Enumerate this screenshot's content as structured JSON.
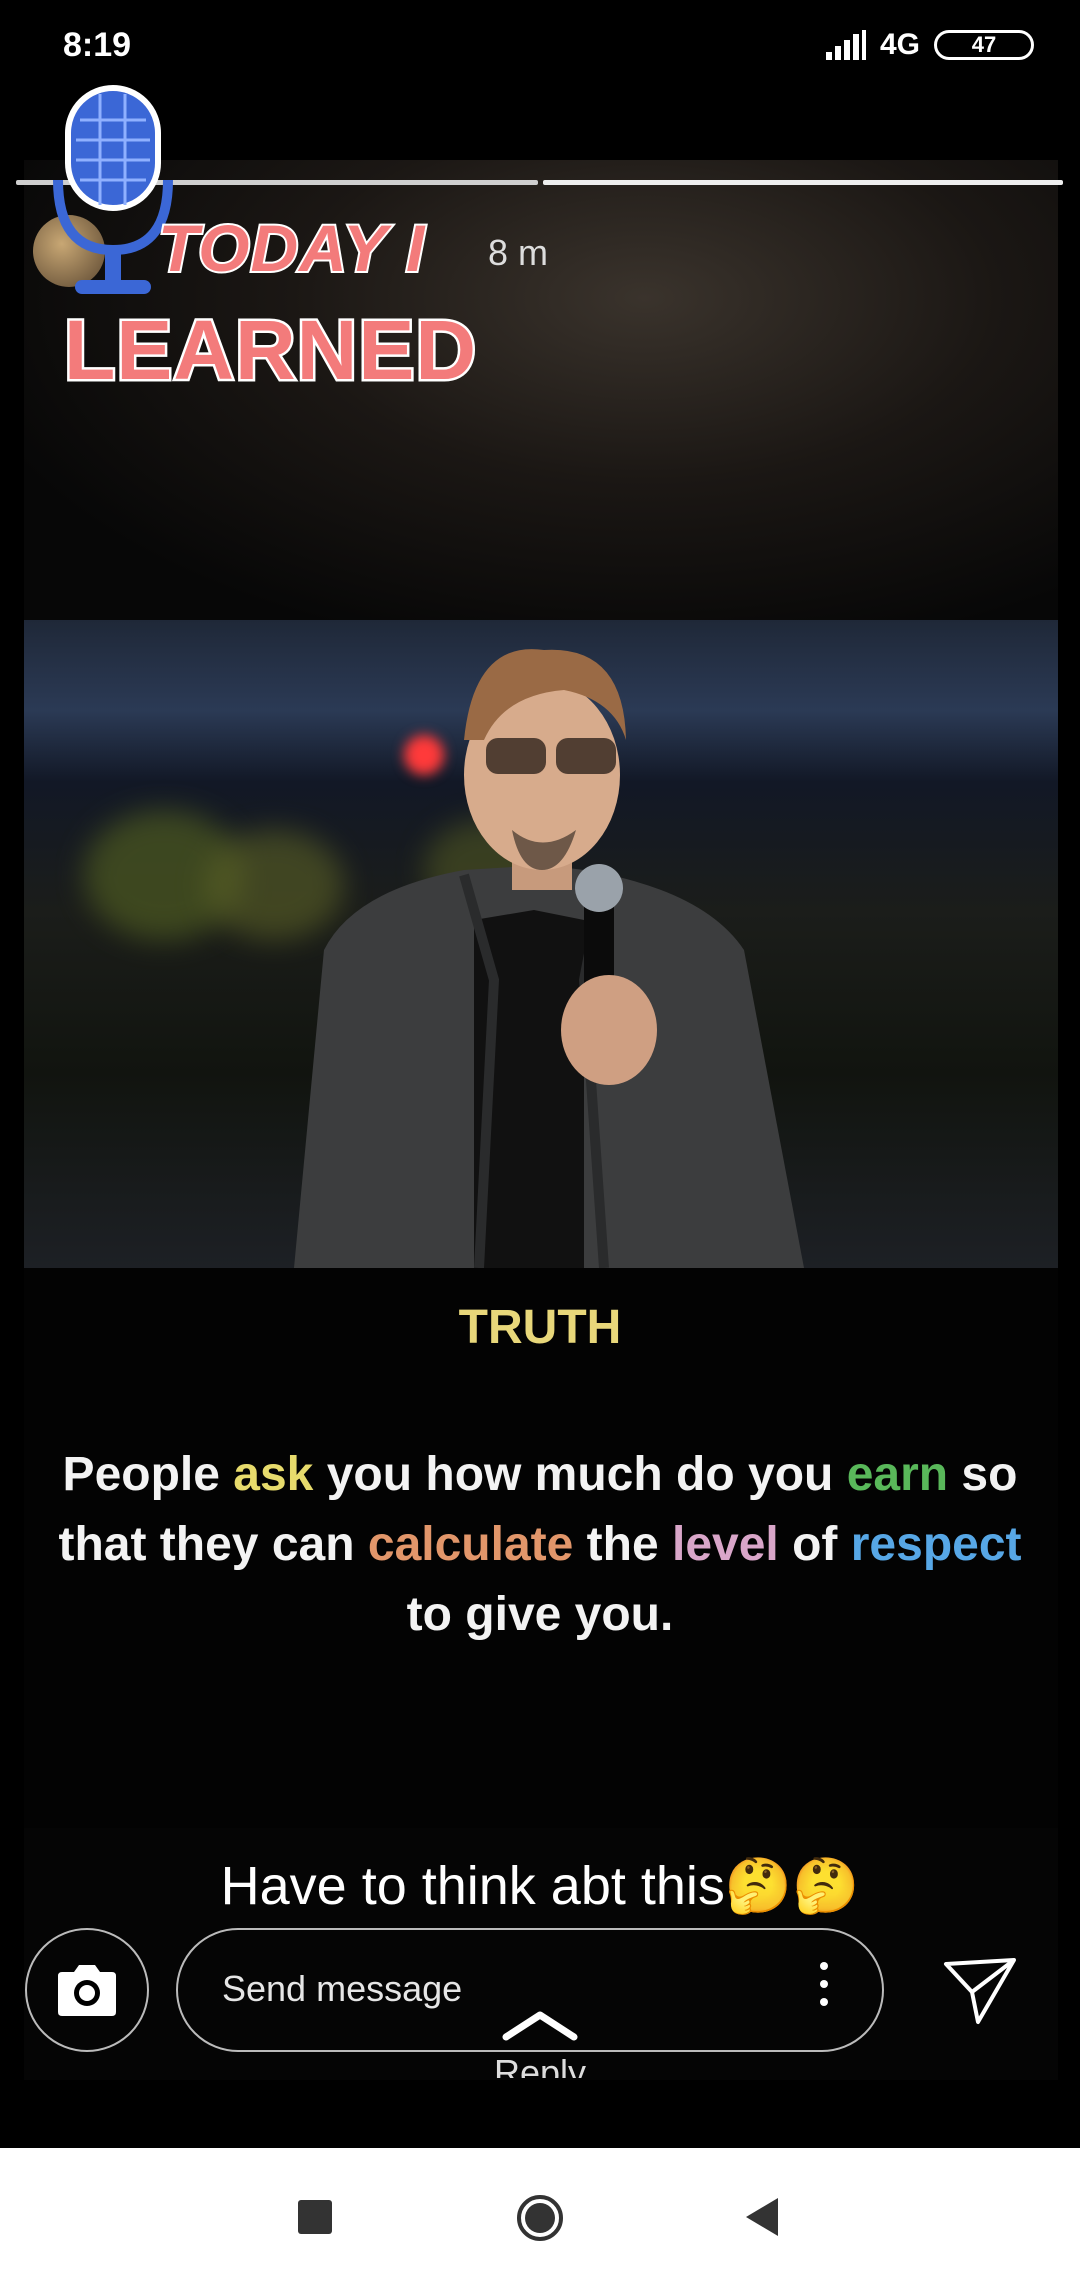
{
  "status_bar": {
    "time": "8:19",
    "network": "4G",
    "battery": "47"
  },
  "story": {
    "posted_ago": "8 m",
    "sticker": {
      "line1": "TODAY I",
      "line2": "LEARNED"
    },
    "post": {
      "title": "TRUTH",
      "quote": {
        "w1": "People ",
        "w2": "ask",
        "w3": " you how much do you ",
        "w4": "earn",
        "w5": " so that they can ",
        "w6": "calculate",
        "w7": " the ",
        "w8": "level",
        "w9": " of ",
        "w10": "respect",
        "w11": " to give you."
      }
    },
    "caption": "Have to think abt this🤔🤔"
  },
  "reply_bar": {
    "placeholder": "Send message",
    "reply_label": "Reply"
  },
  "icons": {
    "camera": "camera-icon",
    "send": "send-icon",
    "more": "more-vertical-icon",
    "reply_up": "chevron-up-icon"
  },
  "colors": {
    "title": "#e8d77a",
    "ask": "#e7db6c",
    "earn": "#59b85a",
    "calculate": "#e2966a",
    "level": "#d9a6c9",
    "respect": "#57a7e6",
    "sticker": "#f37b7b"
  }
}
